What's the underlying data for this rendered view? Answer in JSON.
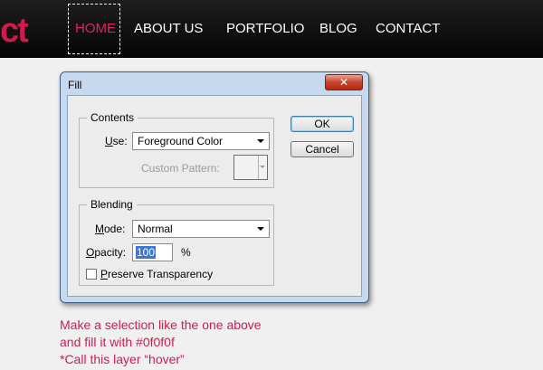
{
  "site": {
    "logo_fragment": "ct",
    "nav": [
      "HOME",
      "ABOUT US",
      "PORTFOLIO",
      "BLOG",
      "CONTACT"
    ],
    "active_item": "HOME",
    "accent_color": "#cc1d4e"
  },
  "dialog": {
    "title": "Fill",
    "close_glyph": "✕",
    "contents": {
      "legend": "Contents",
      "use_label": "Use:",
      "use_value": "Foreground Color",
      "custom_pattern_label": "Custom Pattern:"
    },
    "blending": {
      "legend": "Blending",
      "mode_label": "Mode:",
      "mode_value": "Normal",
      "opacity_label": "Opacity:",
      "opacity_value": "100",
      "opacity_unit": "%",
      "preserve_label": "Preserve Transparency",
      "preserve_checked": false
    },
    "ok_label": "OK",
    "cancel_label": "Cancel"
  },
  "instructions": [
    "Make a selection like the one above",
    "and fill it with #0f0f0f",
    "*Call this layer “hover”"
  ]
}
